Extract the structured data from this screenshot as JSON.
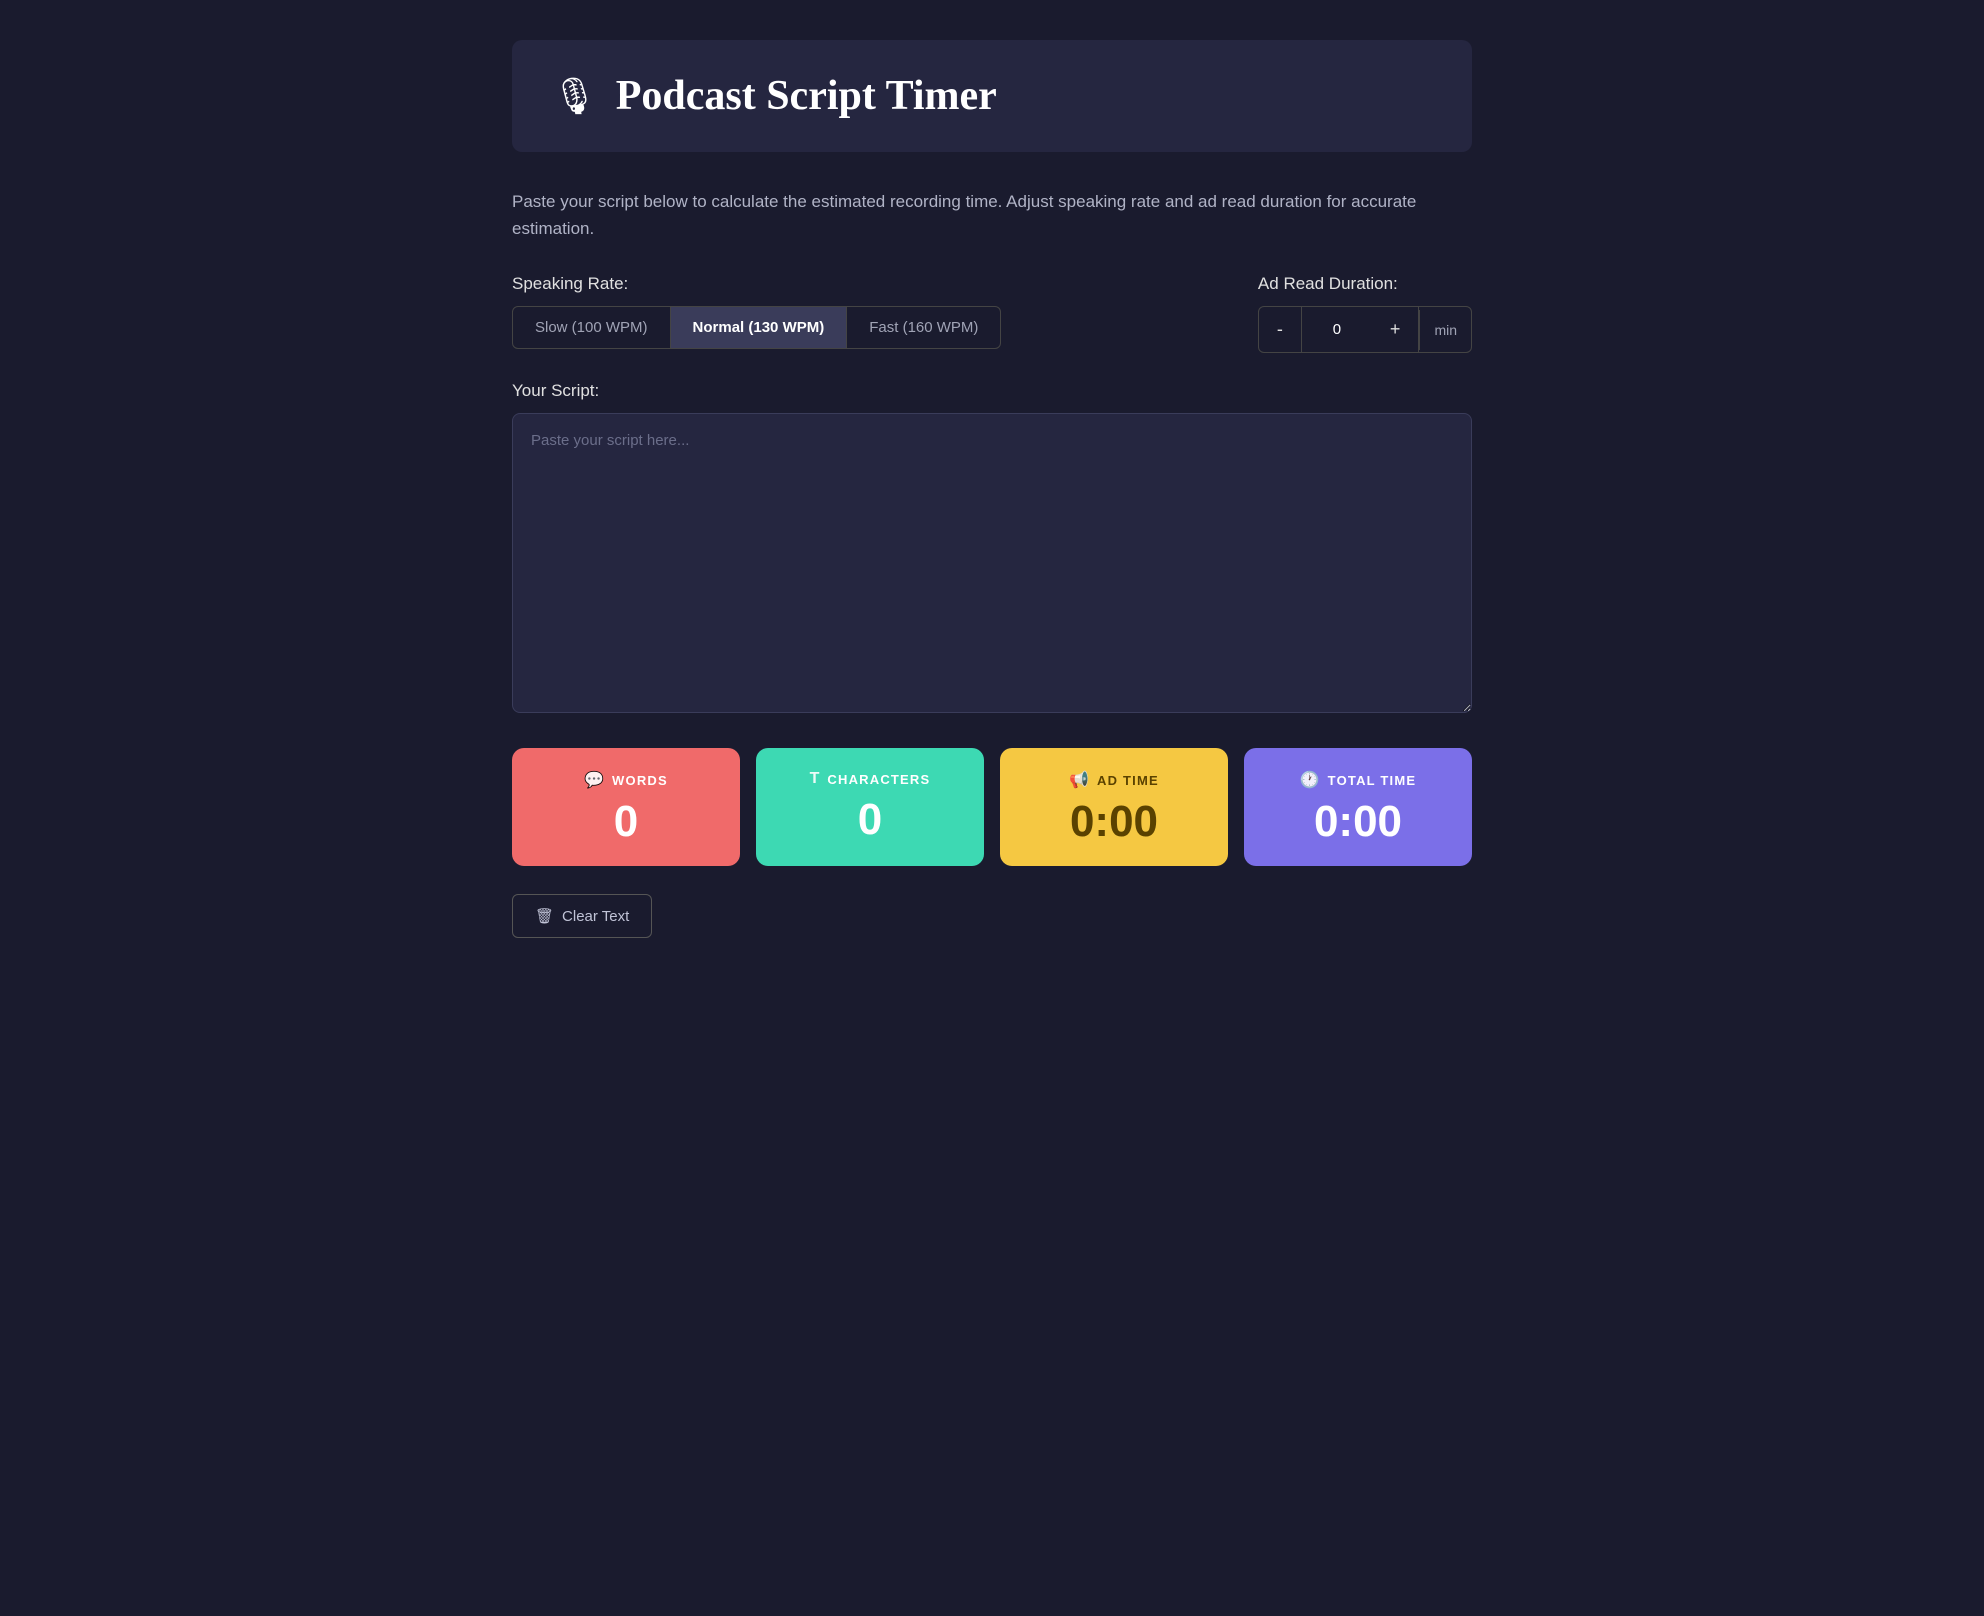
{
  "header": {
    "icon": "🎙",
    "title": "Podcast Script Timer"
  },
  "description": "Paste your script below to calculate the estimated recording time. Adjust speaking rate and ad read duration for accurate estimation.",
  "speaking_rate": {
    "label": "Speaking Rate:",
    "options": [
      {
        "id": "slow",
        "label": "Slow (100 WPM)",
        "active": false
      },
      {
        "id": "normal",
        "label": "Normal (130 WPM)",
        "active": true
      },
      {
        "id": "fast",
        "label": "Fast (160 WPM)",
        "active": false
      }
    ]
  },
  "ad_read": {
    "label": "Ad Read Duration:",
    "value": "0",
    "unit": "min",
    "decrement_label": "-",
    "increment_label": "+"
  },
  "script": {
    "label": "Your Script:",
    "placeholder": "Paste your script here..."
  },
  "stats": [
    {
      "id": "words",
      "icon": "💬",
      "label": "WORDS",
      "value": "0",
      "card_class": "card-words"
    },
    {
      "id": "characters",
      "icon": "T",
      "label": "CHARACTERS",
      "value": "0",
      "card_class": "card-characters"
    },
    {
      "id": "adtime",
      "icon": "📢",
      "label": "AD TIME",
      "value": "0:00",
      "card_class": "card-adtime"
    },
    {
      "id": "totaltime",
      "icon": "🕐",
      "label": "TOTAL TIME",
      "value": "0:00",
      "card_class": "card-totaltime"
    }
  ],
  "clear_button": {
    "icon": "🗑",
    "label": "Clear Text"
  }
}
